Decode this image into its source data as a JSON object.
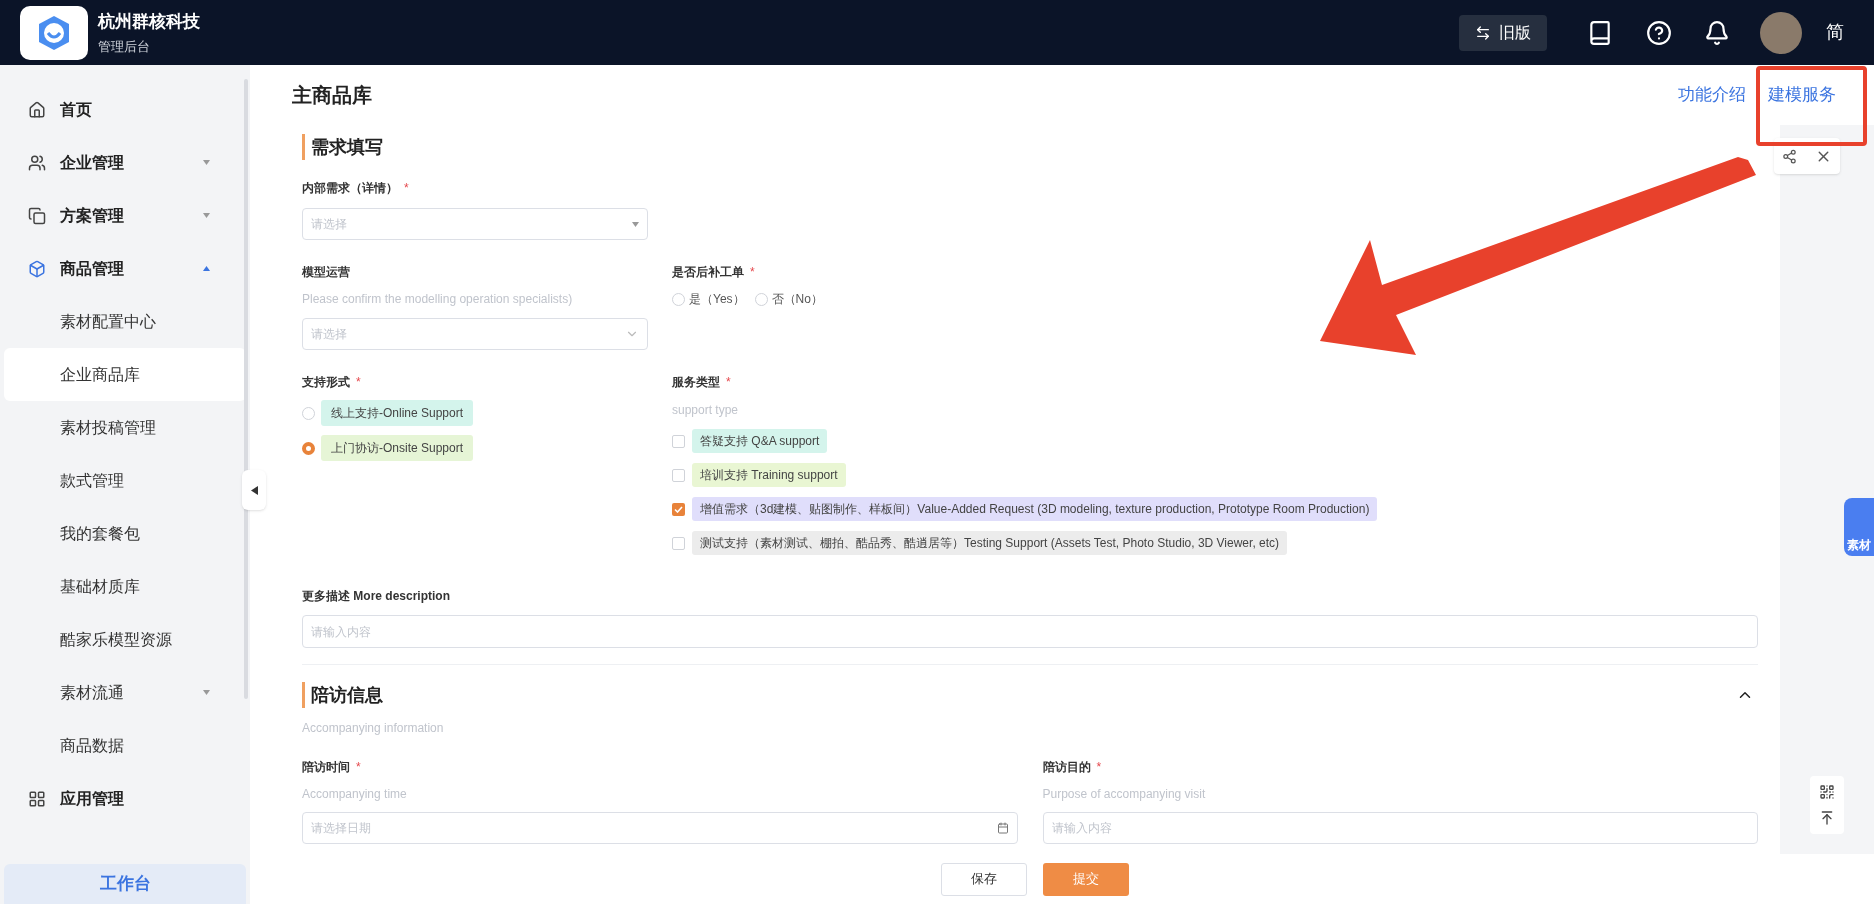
{
  "header": {
    "brand": "杭州群核科技",
    "subtitle": "管理后台",
    "switch_button": "旧版",
    "language": "简"
  },
  "sidebar": {
    "items": [
      {
        "label": "首页",
        "kind": "link"
      },
      {
        "label": "企业管理",
        "kind": "group",
        "expanded": false
      },
      {
        "label": "方案管理",
        "kind": "group",
        "expanded": false
      },
      {
        "label": "商品管理",
        "kind": "group",
        "expanded": true,
        "children": [
          {
            "label": "素材配置中心",
            "selected": false
          },
          {
            "label": "企业商品库",
            "selected": true
          },
          {
            "label": "素材投稿管理",
            "selected": false
          },
          {
            "label": "款式管理",
            "selected": false
          },
          {
            "label": "我的套餐包",
            "selected": false
          },
          {
            "label": "基础材质库",
            "selected": false
          },
          {
            "label": "酷家乐模型资源",
            "selected": false
          },
          {
            "label": "素材流通",
            "selected": false,
            "expanded": false
          },
          {
            "label": "商品数据",
            "selected": false
          }
        ]
      },
      {
        "label": "应用管理",
        "kind": "link"
      }
    ],
    "workbench": "工作台"
  },
  "page": {
    "title": "主商品库",
    "links": [
      "功能介绍",
      "建模服务"
    ]
  },
  "requirement": {
    "title": "需求填写",
    "internal_need": {
      "label": "内部需求（详情）",
      "required_mark": "*",
      "placeholder": "请选择"
    },
    "model_ops": {
      "label": "模型运营",
      "hint": "Please confirm the modelling operation specialists)",
      "placeholder": "请选择"
    },
    "supplement": {
      "label": "是否后补工单",
      "required_mark": "*",
      "options": [
        {
          "label": "是（Yes）",
          "selected": false
        },
        {
          "label": "否（No）",
          "selected": false
        }
      ]
    },
    "support_form": {
      "label": "支持形式",
      "required_mark": "*",
      "options": [
        {
          "label": "线上支持-Online Support",
          "selected": false,
          "color": "#d4f4ec"
        },
        {
          "label": "上门协访-Onsite Support",
          "selected": true,
          "color": "#e6f5d6"
        }
      ]
    },
    "service_type": {
      "label": "服务类型",
      "required_mark": "*",
      "hint": "support type",
      "options": [
        {
          "label": "答疑支持 Q&A support",
          "checked": false,
          "color": "#d4f4ec"
        },
        {
          "label": "培训支持 Training support",
          "checked": false,
          "color": "#e9f6d3"
        },
        {
          "label": "增值需求（3d建模、贴图制作、样板间）Value-Added Request (3D modeling, texture production, Prototype Room Production)",
          "checked": true,
          "color": "#e0defb"
        },
        {
          "label": "测试支持（素材测试、棚拍、酷品秀、酷逍居等）Testing Support (Assets Test, Photo Studio, 3D Viewer, etc)",
          "checked": false,
          "color": "#ececec"
        }
      ]
    },
    "description": {
      "label": "更多描述 More description",
      "placeholder": "请输入内容"
    }
  },
  "accompany": {
    "title": "陪访信息",
    "hint": "Accompanying information",
    "expanded": true,
    "time": {
      "label": "陪访时间",
      "required_mark": "*",
      "hint": "Accompanying time",
      "placeholder": "请选择日期"
    },
    "purpose": {
      "label": "陪访目的",
      "required_mark": "*",
      "hint": "Purpose of accompanying visit",
      "placeholder": "请输入内容"
    }
  },
  "footer": {
    "buttons": [
      {
        "label": "保存",
        "kind": "secondary"
      },
      {
        "label": "提交",
        "kind": "primary"
      }
    ]
  },
  "floating_badge": "素材"
}
